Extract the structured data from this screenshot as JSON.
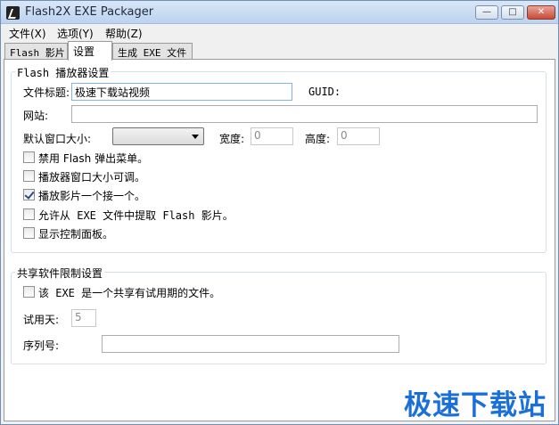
{
  "window": {
    "title": "Flash2X EXE Packager",
    "controls": {
      "minimize": "—",
      "maximize": "□",
      "close": "✕"
    }
  },
  "menu": [
    {
      "label": "文件(X)"
    },
    {
      "label": "选项(Y)"
    },
    {
      "label": "帮助(Z)"
    }
  ],
  "tabs": [
    {
      "label": "Flash 影片",
      "active": false
    },
    {
      "label": "设置",
      "active": true
    },
    {
      "label": "生成 EXE 文件",
      "active": false
    }
  ],
  "flash_group": {
    "title": "Flash 播放器设置",
    "file_title_label": "文件标题:",
    "file_title_value": "极速下载站视频",
    "guid_label": "GUID:",
    "website_label": "网站:",
    "website_value": "",
    "window_size_label": "默认窗口大小:",
    "window_size_value": "",
    "width_label": "宽度:",
    "width_value": "0",
    "height_label": "高度:",
    "height_value": "0",
    "options": [
      {
        "label": "禁用 Flash 弹出菜单。",
        "checked": false
      },
      {
        "label": "播放器窗口大小可调。",
        "checked": false
      },
      {
        "label": "播放影片一个接一个。",
        "checked": true
      },
      {
        "label": "允许从 EXE 文件中提取 Flash 影片。",
        "checked": false
      },
      {
        "label": "显示控制面板。",
        "checked": false
      }
    ]
  },
  "shareware_group": {
    "title": "共享软件限制设置",
    "trial_option": {
      "label": "该 EXE 是一个共享有试用期的文件。",
      "checked": false
    },
    "trial_days_label": "试用天:",
    "trial_days_value": "5",
    "serial_label": "序列号:",
    "serial_value": ""
  },
  "watermark": "极速下载站",
  "colors": {
    "accent_blue": "#1a6fd8",
    "close_red": "#c84a35"
  }
}
